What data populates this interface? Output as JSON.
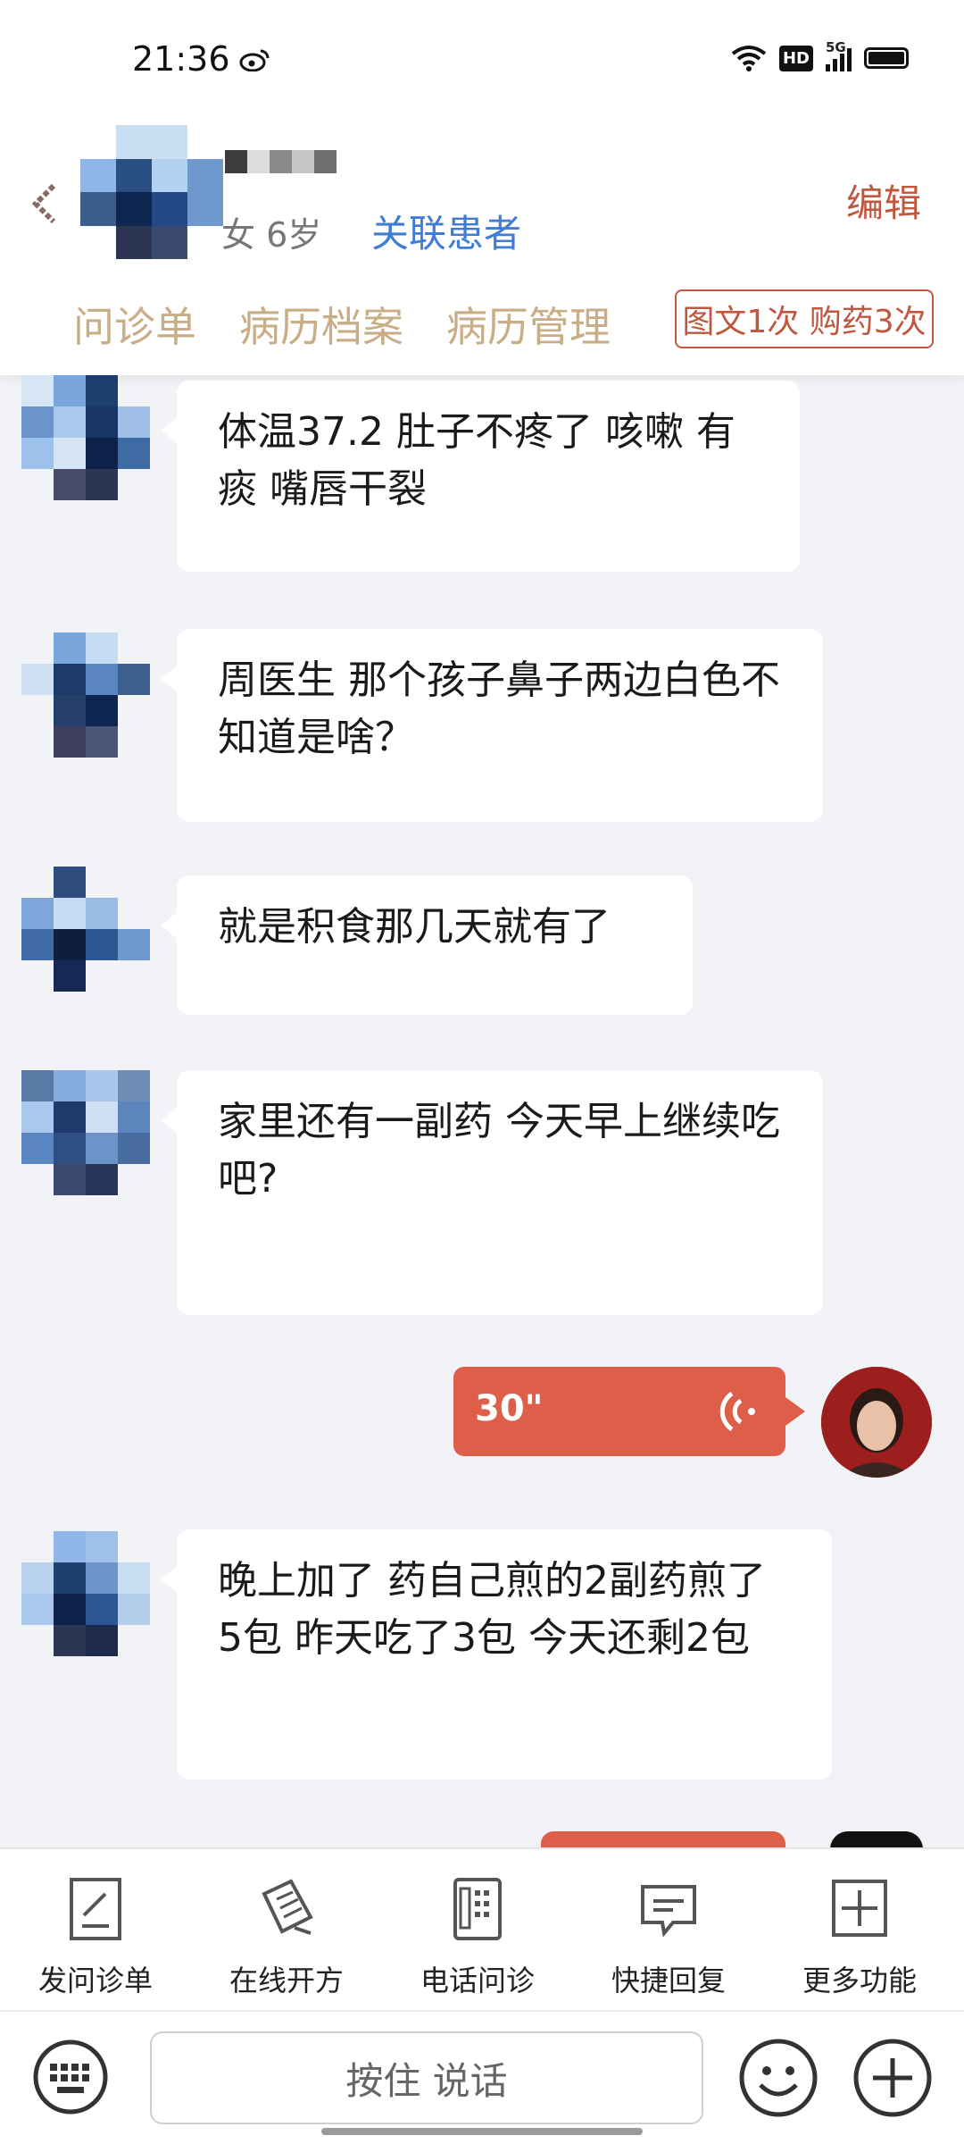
{
  "status_bar": {
    "time": "21:36",
    "hd": "HD",
    "network": "5G"
  },
  "patient": {
    "meta": "女 6岁",
    "link_label": "关联患者"
  },
  "header": {
    "edit_label": "编辑",
    "tabs": [
      "问诊单",
      "病历档案",
      "病历管理"
    ],
    "badge": "图文1次 购药3次"
  },
  "messages": [
    "体温37.2 肚子不疼了 咳嗽 有痰 嘴唇干裂",
    "周医生 那个孩子鼻子两边白色不知道是啥？",
    "就是积食那几天就有了",
    "家里还有一副药 今天早上继续吃吧?",
    "晚上加了 药自己煎的2副药煎了 5包 昨天吃了3包 今天还剩2包"
  ],
  "voice": {
    "duration": "30\""
  },
  "toolbar": [
    "发问诊单",
    "在线开方",
    "电话问诊",
    "快捷回复",
    "更多功能"
  ],
  "input": {
    "hold_to_talk": "按住 说话"
  },
  "colors": {
    "accent": "#c0573f",
    "link": "#3f7cd6",
    "tab": "#c8ad86",
    "voice": "#dd5f4a"
  }
}
